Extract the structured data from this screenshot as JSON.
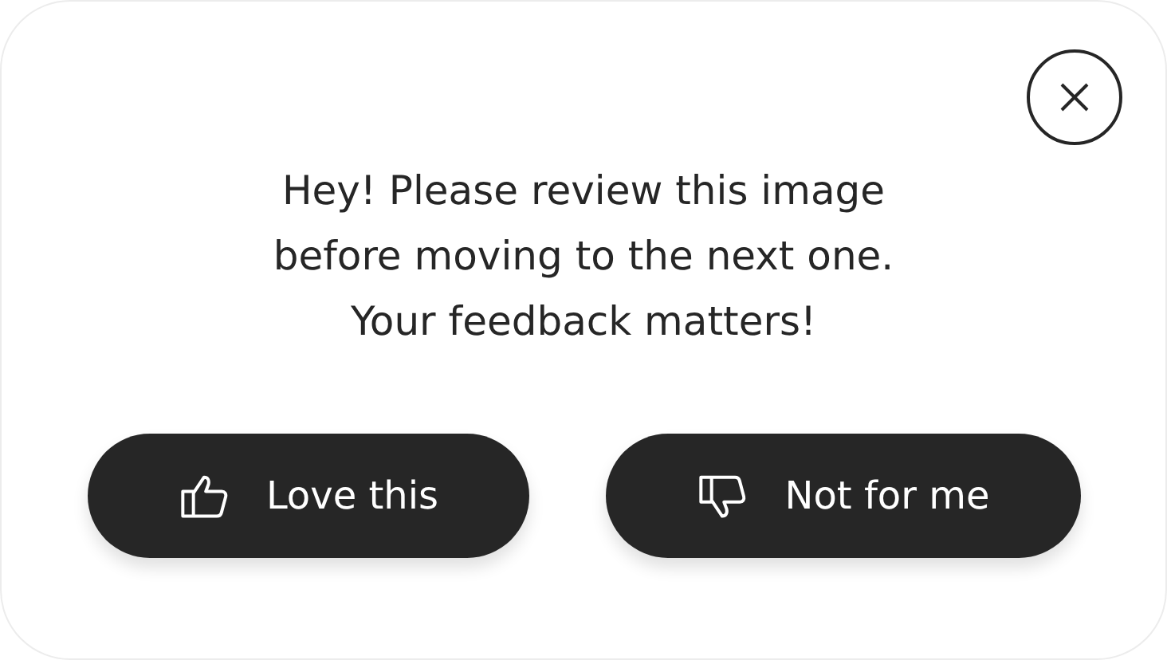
{
  "dialog": {
    "message_lines": [
      "Hey! Please review this image",
      "before moving to the next one.",
      "Your feedback matters!"
    ],
    "buttons": [
      {
        "label": "Love this",
        "kind": "like"
      },
      {
        "label": "Not for me",
        "kind": "dislike"
      }
    ]
  }
}
